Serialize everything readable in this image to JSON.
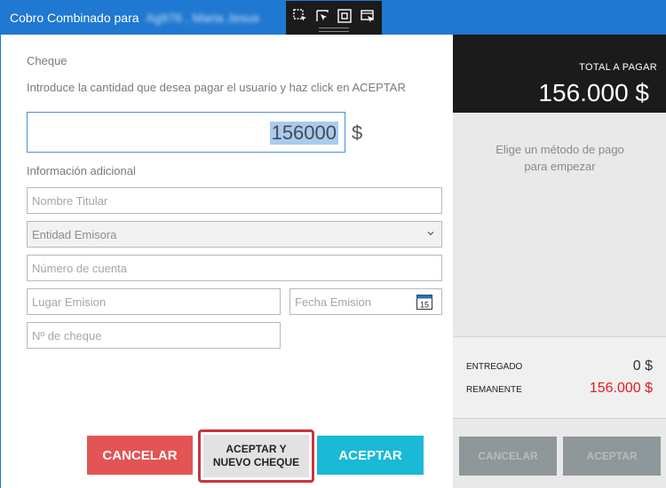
{
  "window": {
    "title_prefix": "Cobro Combinado para",
    "title_name": "Ag976 , Maria Jesus"
  },
  "toolbar_icons": [
    "select-region-icon",
    "cursor-select-icon",
    "fullscreen-icon",
    "window-capture-icon"
  ],
  "form": {
    "section_label": "Cheque",
    "instructions": "Introduce la cantidad que desea pagar el usuario y haz click en ACEPTAR",
    "amount_value": "156000",
    "currency_symbol": "$",
    "info_label": "Información adicional",
    "fields": {
      "holder_name": "Nombre Titular",
      "issuing_entity": "Entidad Emisora",
      "account_number": "Número de cuenta",
      "issue_place": "Lugar Emision",
      "issue_date": "Fecha Emision",
      "check_number": "Nº de cheque"
    },
    "calendar_day": "15",
    "buttons": {
      "cancel": "CANCELAR",
      "accept_new_line1": "ACEPTAR Y",
      "accept_new_line2": "NUEVO CHEQUE",
      "accept": "ACEPTAR"
    }
  },
  "payment": {
    "total_label": "TOTAL A PAGAR",
    "total_amount": "156.000 $",
    "hint_line1": "Elige un método de pago",
    "hint_line2": "para empezar",
    "delivered_label": "ENTREGADO",
    "delivered_value": "0 $",
    "remaining_label": "REMANENTE",
    "remaining_value": "156.000 $",
    "cancel_label": "CANCELAR",
    "accept_label": "ACEPTAR"
  },
  "colors": {
    "titlebar": "#1f78d1",
    "cancel": "#e35454",
    "accept": "#1ab9d6",
    "remaining": "#e31b1b",
    "highlight": "#c8353a"
  }
}
